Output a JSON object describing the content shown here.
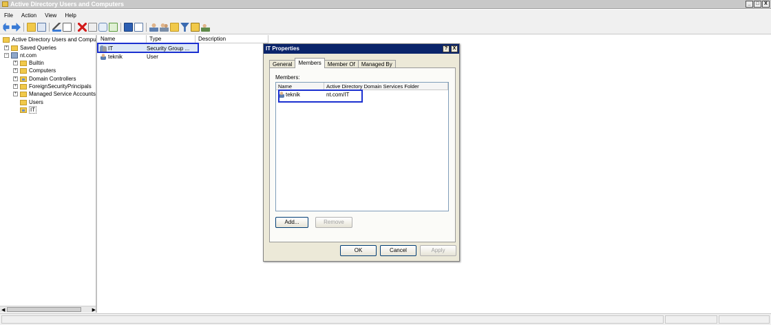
{
  "window": {
    "title": "Active Directory Users and Computers",
    "controls": [
      "_",
      "□",
      "X"
    ]
  },
  "menu": [
    "File",
    "Action",
    "View",
    "Help"
  ],
  "tree": {
    "root": "Active Directory Users and Comput",
    "saved_queries": "Saved Queries",
    "domain": "nt.com",
    "items": [
      "Builtin",
      "Computers",
      "Domain Controllers",
      "ForeignSecurityPrincipals",
      "Managed Service Accounts",
      "Users",
      "IT"
    ]
  },
  "list": {
    "columns": [
      "Name",
      "Type",
      "Description"
    ],
    "rows": [
      {
        "name": "IT",
        "type": "Security Group ...",
        "description": ""
      },
      {
        "name": "teknik",
        "type": "User",
        "description": ""
      }
    ]
  },
  "dialog": {
    "title": "IT Properties",
    "help_btn": "?",
    "close_btn": "X",
    "tabs": [
      "General",
      "Members",
      "Member Of",
      "Managed By"
    ],
    "active_tab": "Members",
    "members_label": "Members:",
    "columns": [
      "Name",
      "Active Directory Domain Services Folder"
    ],
    "members": [
      {
        "name": "teknik",
        "folder": "nt.com/IT"
      }
    ],
    "add_label": "Add...",
    "remove_label": "Remove",
    "ok_label": "OK",
    "cancel_label": "Cancel",
    "apply_label": "Apply"
  },
  "colors": {
    "highlight_box": "#1a2fd0",
    "dialog_title_bg": "#0a246a",
    "selection_bg": "#dde8f6"
  }
}
